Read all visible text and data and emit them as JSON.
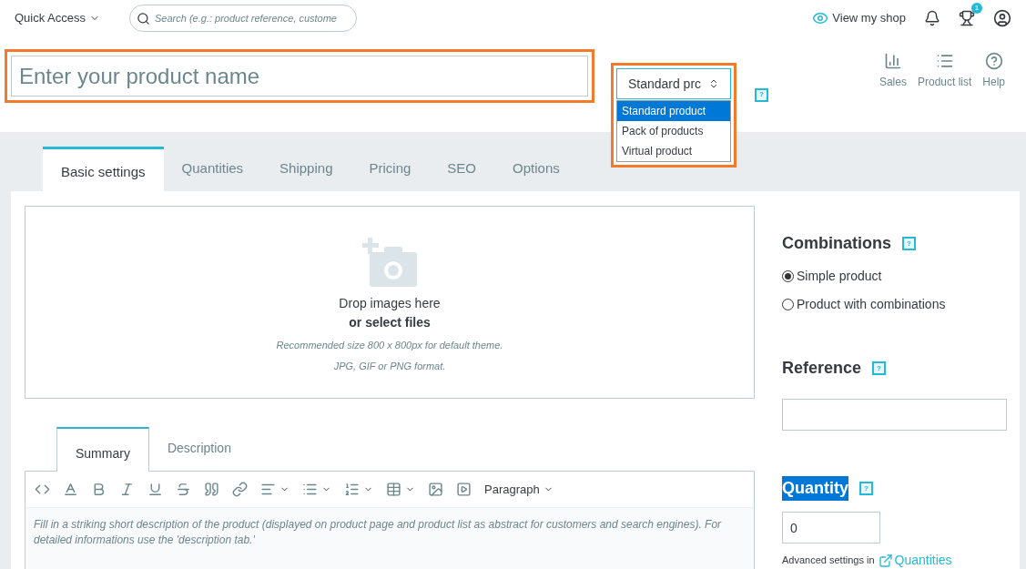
{
  "top_bar": {
    "quick_access": "Quick Access",
    "search": {
      "placeholder": "Search (e.g.: product reference, custome"
    },
    "view_shop": "View my shop",
    "notifications_badge": "1"
  },
  "header": {
    "product_name": {
      "placeholder": "Enter your product name",
      "highlighted": true
    },
    "type_selector": {
      "value": "Standard prc",
      "highlighted": true,
      "expanded": true,
      "help": "?",
      "options": [
        {
          "label": "Standard product",
          "selected": true
        },
        {
          "label": "Pack of products",
          "selected": false
        },
        {
          "label": "Virtual product",
          "selected": false
        }
      ]
    },
    "actions": [
      {
        "kind": "sales",
        "label": "Sales"
      },
      {
        "kind": "list",
        "label": "Product list"
      },
      {
        "kind": "help",
        "label": "Help"
      }
    ]
  },
  "tabs": [
    {
      "label": "Basic settings",
      "selected": true
    },
    {
      "label": "Quantities",
      "selected": false
    },
    {
      "label": "Shipping",
      "selected": false
    },
    {
      "label": "Pricing",
      "selected": false
    },
    {
      "label": "SEO",
      "selected": false
    },
    {
      "label": "Options",
      "selected": false
    }
  ],
  "dropzone": {
    "title": "Drop images here",
    "action": "or select files",
    "hints": [
      "Recommended size 800 x 800px for default theme.",
      "JPG, GIF or PNG format."
    ]
  },
  "editor": {
    "tabs": [
      {
        "label": "Summary",
        "selected": true
      },
      {
        "label": "Description",
        "selected": false
      }
    ],
    "format": "Paragraph",
    "placeholder": "Fill in a striking short description of the product (displayed on product page and product list as abstract for customers and search engines). For detailed informations use the 'description tab.'"
  },
  "combinations": {
    "title": "Combinations",
    "help": "?",
    "options": [
      {
        "label": "Simple product",
        "selected": true
      },
      {
        "label": "Product with combinations",
        "selected": false
      }
    ]
  },
  "reference": {
    "title": "Reference",
    "help": "?"
  },
  "quantity": {
    "title": "Quantity",
    "highlighted": true,
    "help": "?",
    "value": "0",
    "advanced": "Advanced settings in",
    "link": "Quantities"
  }
}
